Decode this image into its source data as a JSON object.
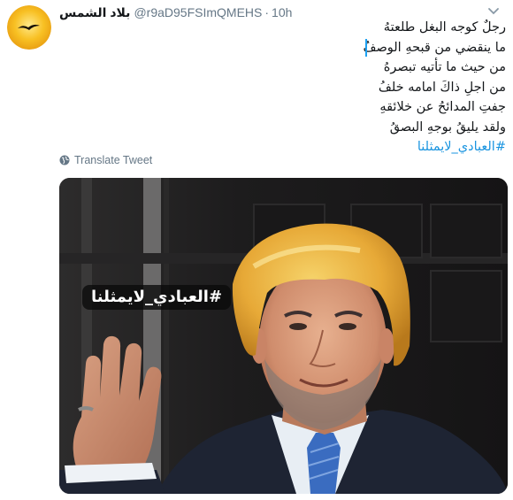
{
  "tweet": {
    "display_name": "بلاد الشمس",
    "handle": "@r9aD95FSImQMEHS",
    "separator": "·",
    "time": "10h",
    "lines": [
      "رجلٌ كوجه البغل طلعتهُ",
      "ما ينقضي من قبحهِ الوصفُ",
      "من حيث ما تأتيه تبصرهُ",
      "من اجلِ ذاكَ امامه خلفُ",
      "جفتِ المدائحُ عن خلائقهِ",
      "ولقد يليقُ بوجهِ البصقُ"
    ],
    "hashtag": "#العبادي_لايمثلنا",
    "translate_label": "Translate Tweet"
  },
  "media": {
    "overlay_text": "#العبادي_لايمثلنا"
  },
  "icons": {
    "avatar": "sun-bird-avatar-icon",
    "caret": "chevron-down-icon",
    "translate": "globe-icon"
  },
  "colors": {
    "link": "#1b95e0",
    "muted": "#657786",
    "accent_bar": "#1da1f2"
  }
}
